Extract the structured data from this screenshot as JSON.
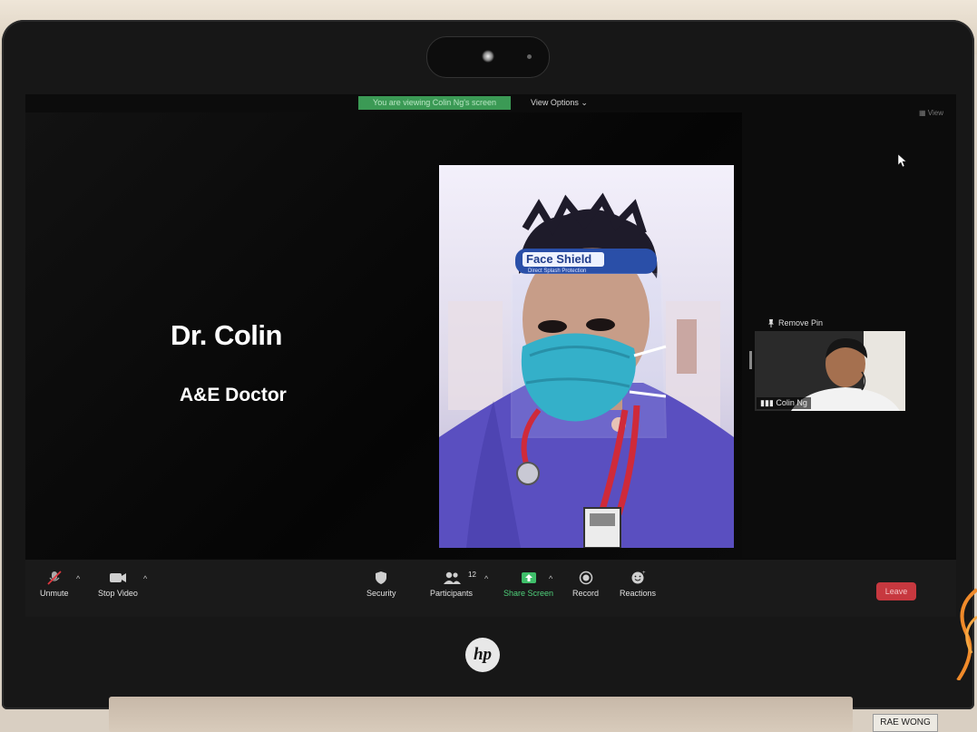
{
  "topbar": {
    "banner_text": "You are viewing Colin Ng's screen",
    "view_options_label": "View Options ⌄",
    "view_label": "View",
    "shield_icon": "shield-icon",
    "banner_color": "#3b9a55"
  },
  "slide": {
    "title": "Dr. Colin",
    "subtitle": "A&E Doctor"
  },
  "main_video": {
    "face_shield_text": "Face Shield",
    "face_shield_subtext": "Direct Splash Protection"
  },
  "thumbnail": {
    "pin_label": "Remove Pin",
    "participant_name": "Colin Ng"
  },
  "toolbar": {
    "unmute_label": "Unmute",
    "stop_video_label": "Stop Video",
    "security_label": "Security",
    "participants_label": "Participants",
    "participants_count": "12",
    "share_screen_label": "Share Screen",
    "record_label": "Record",
    "reactions_label": "Reactions",
    "leave_label": "Leave",
    "leave_color": "#c7383f",
    "share_color": "#4fd07a"
  },
  "device": {
    "brand_logo": "hp",
    "name_tag": "RAE WONG"
  }
}
